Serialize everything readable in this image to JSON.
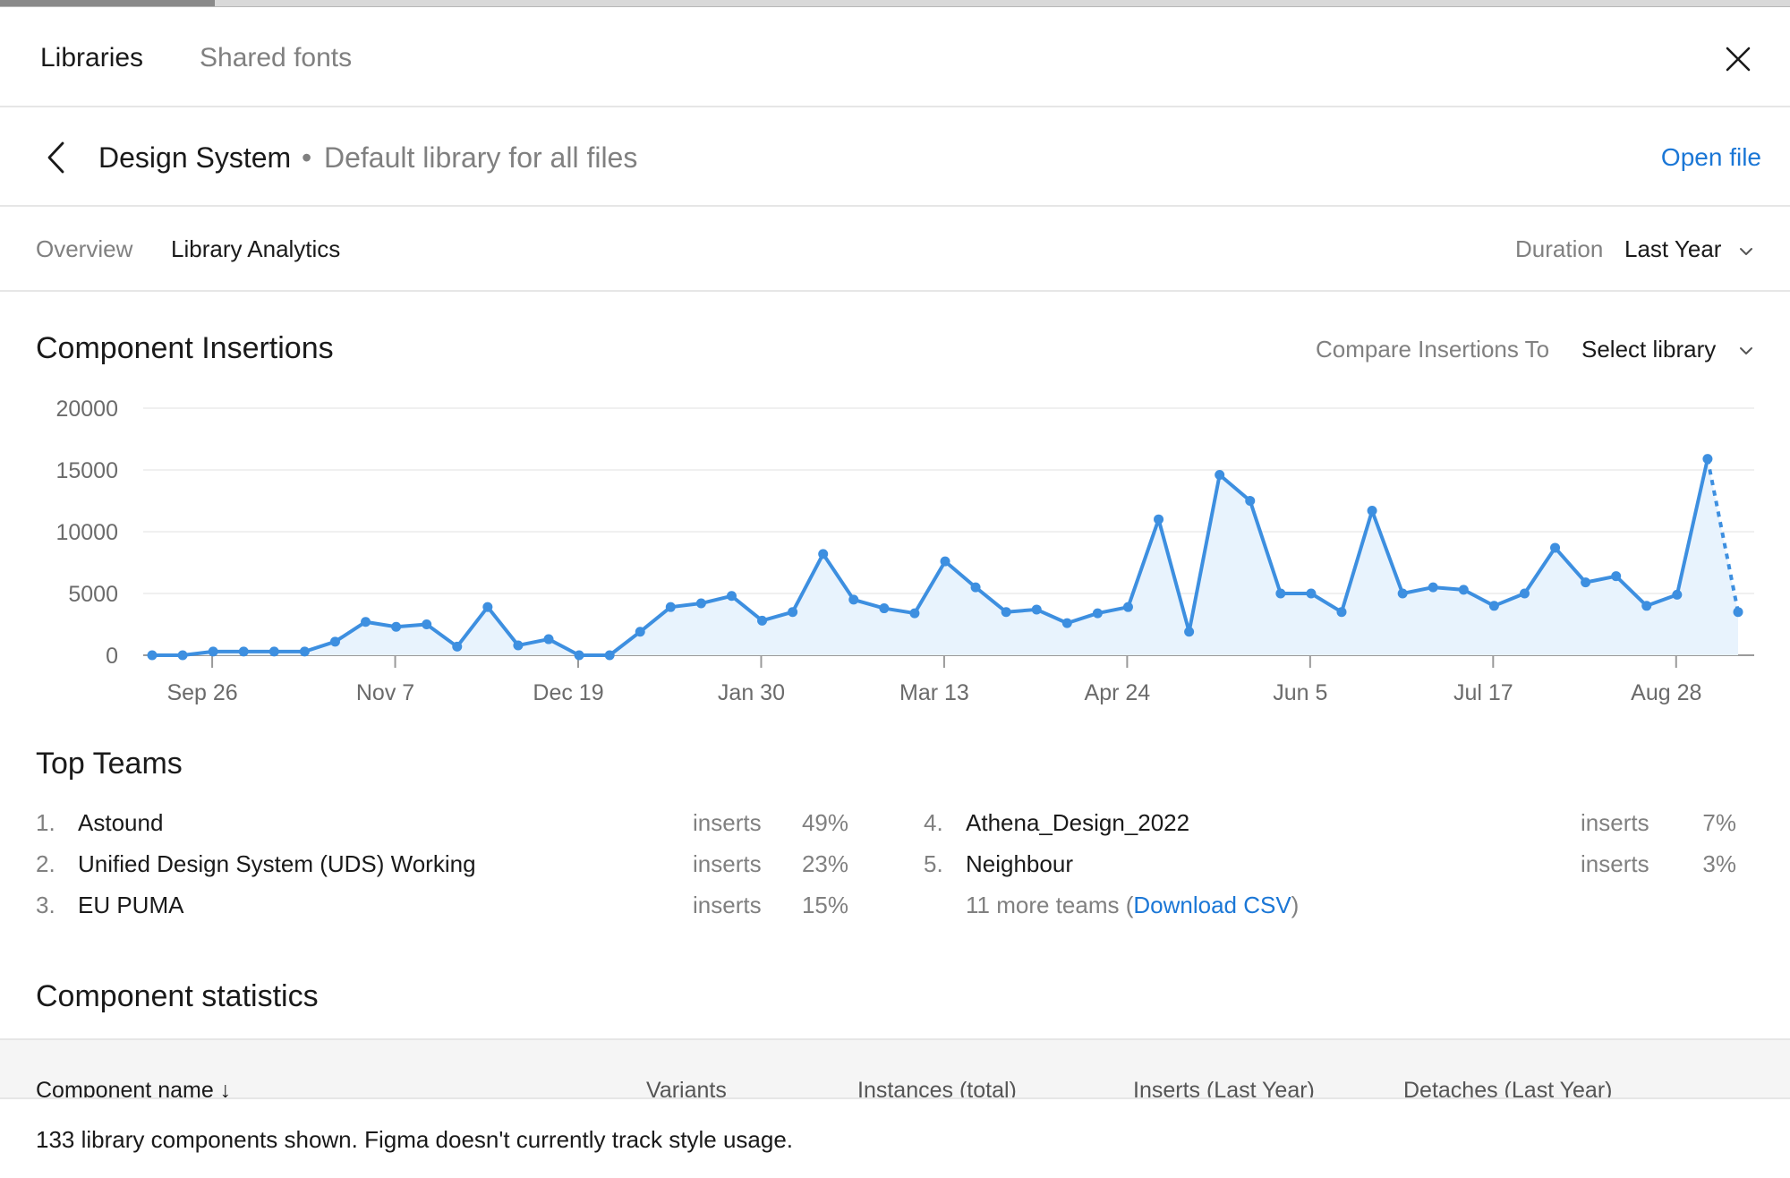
{
  "header": {
    "tabs": [
      {
        "label": "Libraries",
        "active": true
      },
      {
        "label": "Shared fonts",
        "active": false
      }
    ]
  },
  "library": {
    "name": "Design System",
    "separator": "•",
    "description": "Default library for all files",
    "open_file_label": "Open file"
  },
  "tabs": {
    "overview": "Overview",
    "analytics": "Library Analytics"
  },
  "duration": {
    "label": "Duration",
    "value": "Last Year"
  },
  "insertions": {
    "title": "Component Insertions",
    "compare_label": "Compare Insertions To",
    "compare_value": "Select library"
  },
  "chart_data": {
    "type": "area",
    "title": "Component Insertions",
    "ylim": [
      0,
      20000
    ],
    "yticks": [
      0,
      5000,
      10000,
      15000,
      20000
    ],
    "xtick_labels": [
      "Sep 26",
      "Nov 7",
      "Dec 19",
      "Jan 30",
      "Mar 13",
      "Apr 24",
      "Jun 5",
      "Jul 17",
      "Aug 28"
    ],
    "values": [
      0,
      0,
      300,
      300,
      300,
      300,
      1100,
      2700,
      2300,
      2500,
      700,
      3900,
      800,
      1300,
      0,
      0,
      1900,
      3900,
      4200,
      4800,
      2800,
      3500,
      8200,
      4500,
      3800,
      3400,
      7600,
      5500,
      3500,
      3700,
      2600,
      3400,
      3900,
      11000,
      1900,
      14600,
      12500,
      5000,
      5000,
      3500,
      11700,
      5000,
      5500,
      5300,
      4000,
      5000,
      8700,
      5900,
      6400,
      4000,
      4900,
      15900,
      3500
    ],
    "projected_last_point": true,
    "colors": {
      "line": "#3d8fe0",
      "fill": "#e8f3fd",
      "grid": "#ececec",
      "axis": "#9a9a9a"
    },
    "grid": true
  },
  "top_teams": {
    "title": "Top Teams",
    "insert_word": "inserts",
    "left": [
      {
        "rank": "1.",
        "name": "Astound",
        "pct": "49%"
      },
      {
        "rank": "2.",
        "name": "Unified Design System (UDS) Working",
        "pct": "23%"
      },
      {
        "rank": "3.",
        "name": "EU PUMA",
        "pct": "15%"
      }
    ],
    "right": [
      {
        "rank": "4.",
        "name": "Athena_Design_2022",
        "pct": "7%"
      },
      {
        "rank": "5.",
        "name": "Neighbour",
        "pct": "3%"
      }
    ],
    "more_prefix": "11 more teams (",
    "more_link": "Download CSV",
    "more_suffix": ")"
  },
  "stats": {
    "title": "Component statistics",
    "columns": [
      "Component name ↓",
      "Variants",
      "Instances (total)",
      "Inserts (Last Year)",
      "Detaches (Last Year)"
    ]
  },
  "footer": {
    "text": "133 library components shown. Figma doesn't currently track style usage."
  },
  "icons": [
    "close-icon",
    "back-chevron-icon",
    "chevron-down-icon"
  ]
}
